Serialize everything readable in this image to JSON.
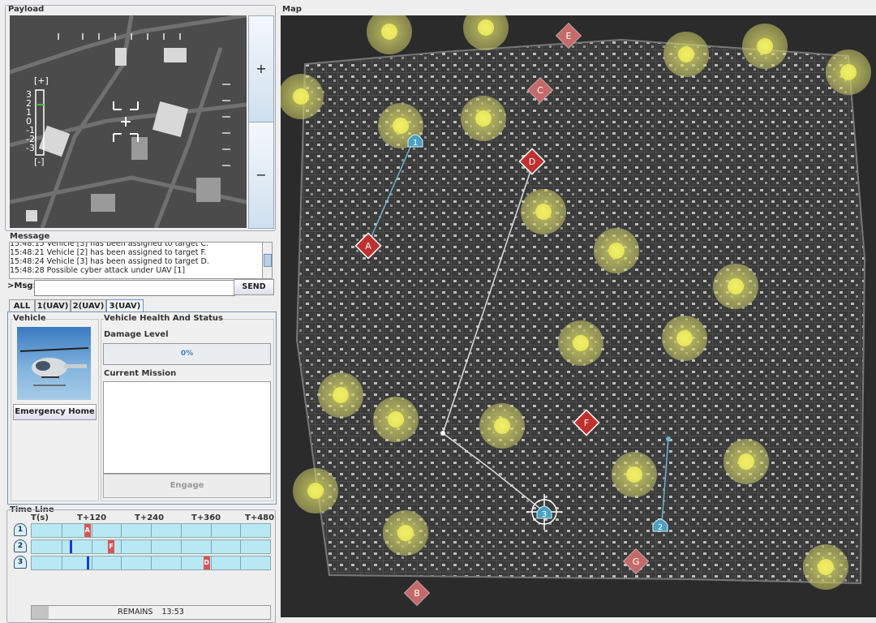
{
  "payload": {
    "title": "Payload",
    "zoom_in_label": "+",
    "zoom_out_label": "−",
    "altitude_top": "[+]",
    "altitude_bottom": "[-]",
    "altitude_ticks": [
      "3",
      "2",
      "1",
      "0",
      "-1",
      "-2",
      "-3"
    ]
  },
  "message": {
    "title": "Message",
    "log": [
      "15:48:15  Vehicle [3] has been assigned to target C.",
      "15:48:21  Vehicle [2] has been assigned to target F.",
      "15:48:24  Vehicle [3] has been assigned to target D.",
      "15:48:28  Possible cyber attack under UAV [1]"
    ],
    "input_label": ">Msg:",
    "input_value": "",
    "send_label": "SEND"
  },
  "tabs": [
    {
      "label": "ALL",
      "active": false
    },
    {
      "label": "1(UAV)",
      "active": false
    },
    {
      "label": "2(UAV)",
      "active": false
    },
    {
      "label": "3(UAV)",
      "active": true
    }
  ],
  "vehicle": {
    "title": "Vehicle",
    "emergency_label": "Emergency Home"
  },
  "health": {
    "title": "Vehicle Health And Status",
    "damage_label": "Damage Level",
    "damage_value": "0%",
    "mission_label": "Current Mission",
    "mission_value": "",
    "engage_label": "Engage"
  },
  "timeline": {
    "title": "Time Line",
    "headers": [
      "T(s)",
      "T+120",
      "T+240",
      "T+360",
      "T+480"
    ],
    "rows": [
      {
        "vehicle": "1",
        "markers": [
          {
            "label": "A",
            "t": 110
          }
        ],
        "progress_t": null
      },
      {
        "vehicle": "2",
        "markers": [
          {
            "label": "F",
            "t": 160
          }
        ],
        "progress_t": 80
      },
      {
        "vehicle": "3",
        "markers": [
          {
            "label": "D",
            "t": 360
          }
        ],
        "progress_t": 115
      }
    ],
    "remains_label": "REMAINS",
    "remains_value": "13:53",
    "remains_fraction": 0.07
  },
  "map": {
    "title": "Map",
    "colors": {
      "target": "#c0302f",
      "target_faded": "#c56a6a",
      "vehicle": "#4aa0c0",
      "threat": "#e8e65a"
    },
    "targets": [
      "A",
      "B",
      "C",
      "D",
      "E",
      "F",
      "G"
    ],
    "vehicles": [
      "1",
      "2",
      "3"
    ]
  }
}
